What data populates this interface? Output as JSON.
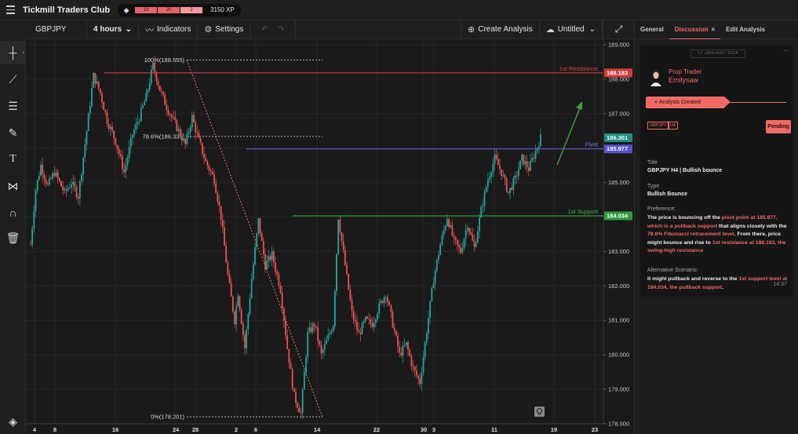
{
  "app": {
    "brand": "Tickmill Traders Club",
    "xp_segments": [
      "19",
      "20",
      "2"
    ],
    "xp_value": "3150 XP"
  },
  "toolbar": {
    "symbol": "GBPJPY",
    "interval": "4 hours",
    "indicators": "Indicators",
    "settings": "Settings",
    "create_analysis": "Create Analysis",
    "layout_name": "Untitled"
  },
  "chart": {
    "price_axis": [
      "189.000",
      "188.000",
      "187.000",
      "186.000",
      "185.000",
      "184.000",
      "183.000",
      "182.000",
      "181.000",
      "180.000",
      "179.000",
      "178.000"
    ],
    "time_axis": [
      "4",
      "8",
      "16",
      "24",
      "28",
      "2",
      "6",
      "14",
      "22",
      "30",
      "3",
      "11",
      "19",
      "23"
    ],
    "fib_100": "100%(188.555)",
    "fib_786": "78.6%(186.339)",
    "fib_0": "0%(178.201)",
    "resistance_label": "1st Resistance",
    "resistance_price": "188.183",
    "pivot_label": "Pivot",
    "pivot_price": "185.977",
    "support_label": "1st Support",
    "support_price": "184.034",
    "last_price": "186.301",
    "colors": {
      "up": "#26a69a",
      "down": "#ef5350",
      "resistance": "#e04848",
      "pivot": "#6a64d8",
      "support": "#3cb44b"
    }
  },
  "panel": {
    "tabs": [
      "General",
      "Discussion",
      "Edit Analysis"
    ],
    "date": "17 JANUARY 2024",
    "role": "Prop Trader",
    "username": "Emilysaw",
    "status_line": "Analysis Created",
    "tags": [
      "GBPJPY",
      "H4"
    ],
    "status": "Pending",
    "title_label": "Title",
    "title_value": "GBPJPY H4 | Bullish bounce",
    "type_label": "Type",
    "type_value": "Bullish Bounce",
    "preference_label": "Preference:",
    "preference": [
      {
        "t": "The price is bouncing off the ",
        "hl": false
      },
      {
        "t": "pivot point at 185.977, which is a pullback support",
        "hl": true
      },
      {
        "t": " that aligns closely with the ",
        "hl": false
      },
      {
        "t": "78.6% Fibonacci retracement level",
        "hl": true
      },
      {
        "t": ". From there, price might bounce and rise to ",
        "hl": false
      },
      {
        "t": "1st resistance at 188.183, the swing-high resistance",
        "hl": true
      }
    ],
    "alt_label": "Alternative Scenario:",
    "alternative": [
      {
        "t": "It might pullback and reverse to the ",
        "hl": false
      },
      {
        "t": "1st support level at 184.034, the pullback support",
        "hl": true
      },
      {
        "t": ".",
        "hl": false
      }
    ],
    "time": "14:37"
  }
}
